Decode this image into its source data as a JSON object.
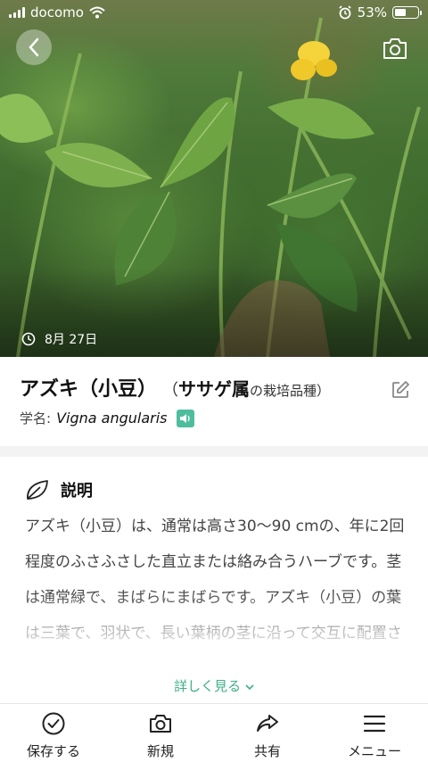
{
  "status_bar": {
    "carrier": "docomo",
    "battery_text": "53%",
    "battery_level": 0.53
  },
  "hero": {
    "date": "8月 27日"
  },
  "plant": {
    "name": "アズキ（小豆）",
    "paren_open": "（",
    "genus": "ササゲ属",
    "genus_note": "の栽培品種）",
    "sci_label": "学名:",
    "sci_name": "Vigna angularis"
  },
  "description": {
    "title": "説明",
    "body": "アズキ（小豆）は、通常は高さ30〜90 cmの、年に2回程度のふさふさした直立または絡み合うハーブです。茎は通常緑で、まばらにまばらです。アズキ（小豆）の葉は三葉で、羽状で、長い葉柄の茎に沿って交互に配置されます。リーフレッ",
    "more_label": "詳しく見る"
  },
  "nav": {
    "items": [
      {
        "label": "保存する",
        "icon": "check-circle-icon"
      },
      {
        "label": "新規",
        "icon": "camera-icon"
      },
      {
        "label": "共有",
        "icon": "share-icon"
      },
      {
        "label": "メニュー",
        "icon": "menu-icon"
      }
    ]
  },
  "colors": {
    "accent": "#3fae8a",
    "speaker": "#4dbd9e"
  }
}
